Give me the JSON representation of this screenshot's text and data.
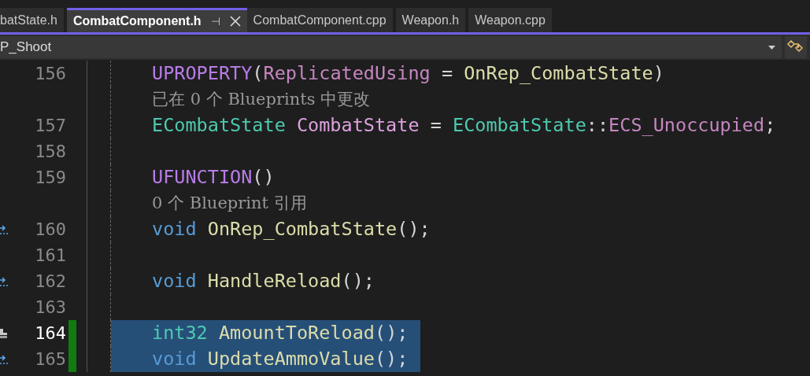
{
  "tabs": [
    {
      "label": "batState.h",
      "selected": false
    },
    {
      "label": "CombatComponent.h",
      "selected": true,
      "pin": "⊣"
    },
    {
      "label": "CombatComponent.cpp",
      "selected": false
    },
    {
      "label": "Weapon.h",
      "selected": false
    },
    {
      "label": "Weapon.cpp",
      "selected": false
    }
  ],
  "nav_bar": {
    "member_dropdown": "P_Shoot"
  },
  "lines": [
    {
      "kind": "code",
      "number": "156",
      "current": false,
      "changed": false,
      "selected": false,
      "tokens": [
        {
          "text": "UPROPERTY",
          "color": "#b77ce8"
        },
        {
          "text": "(",
          "color": "#d4d4d4"
        },
        {
          "text": "ReplicatedUsing",
          "color": "#c586c0"
        },
        {
          "text": " = ",
          "color": "#d4d4d4"
        },
        {
          "text": "OnRep_CombatState",
          "color": "#dcdcaa"
        },
        {
          "text": ")",
          "color": "#d4d4d4"
        }
      ]
    },
    {
      "kind": "hint",
      "text": "已在 0 个 Blueprints 中更改"
    },
    {
      "kind": "code",
      "number": "157",
      "current": false,
      "changed": false,
      "selected": false,
      "tokens": [
        {
          "text": "ECombatState",
          "color": "#4ec9b0"
        },
        {
          "text": " CombatState",
          "color": "#dda0dd"
        },
        {
          "text": " = ",
          "color": "#d4d4d4"
        },
        {
          "text": "ECombatState",
          "color": "#4ec9b0"
        },
        {
          "text": "::",
          "color": "#d4d4d4"
        },
        {
          "text": "ECS_Unoccupied",
          "color": "#c586c0"
        },
        {
          "text": ";",
          "color": "#d4d4d4"
        }
      ]
    },
    {
      "kind": "code",
      "number": "158",
      "current": false,
      "changed": false,
      "selected": false
    },
    {
      "kind": "code",
      "number": "159",
      "current": false,
      "changed": false,
      "selected": false,
      "tokens": [
        {
          "text": "UFUNCTION",
          "color": "#b77ce8"
        },
        {
          "text": "()",
          "color": "#d4d4d4"
        }
      ]
    },
    {
      "kind": "hint",
      "text": "0 个 Blueprint 引用"
    },
    {
      "kind": "code",
      "number": "160",
      "gutter_icon": {
        "kind": "arrow"
      },
      "current": false,
      "changed": false,
      "selected": false,
      "tokens": [
        {
          "text": "void",
          "color": "#569cd6"
        },
        {
          "text": " OnRep_CombatState",
          "color": "#dcdcaa"
        },
        {
          "text": "();",
          "color": "#d4d4d4"
        }
      ]
    },
    {
      "kind": "code",
      "number": "161",
      "current": false,
      "changed": false,
      "selected": false
    },
    {
      "kind": "code",
      "number": "162",
      "gutter_icon": {
        "kind": "arrow"
      },
      "current": false,
      "changed": false,
      "selected": false,
      "tokens": [
        {
          "text": "void",
          "color": "#569cd6"
        },
        {
          "text": " HandleReload",
          "color": "#dcdcaa"
        },
        {
          "text": "();",
          "color": "#d4d4d4"
        }
      ]
    },
    {
      "kind": "code",
      "number": "163",
      "current": false,
      "changed": false,
      "selected": false
    },
    {
      "kind": "code",
      "number": "164",
      "gutter_icon": {
        "kind": "brush"
      },
      "current": true,
      "changed": true,
      "selected": true,
      "tokens": [
        {
          "text": "int32",
          "color": "#4ec9b0"
        },
        {
          "text": " AmountToReload",
          "color": "#dcdcaa"
        },
        {
          "text": "();",
          "color": "#d4d4d4"
        }
      ]
    },
    {
      "kind": "code",
      "number": "165",
      "gutter_icon": {
        "kind": "arrow"
      },
      "current": false,
      "changed": true,
      "selected": true,
      "tokens": [
        {
          "text": "void",
          "color": "#569cd6"
        },
        {
          "text": " UpdateAmmoValue",
          "color": "#dcdcaa"
        },
        {
          "text": "();",
          "color": "#d4d4d4"
        }
      ]
    }
  ]
}
